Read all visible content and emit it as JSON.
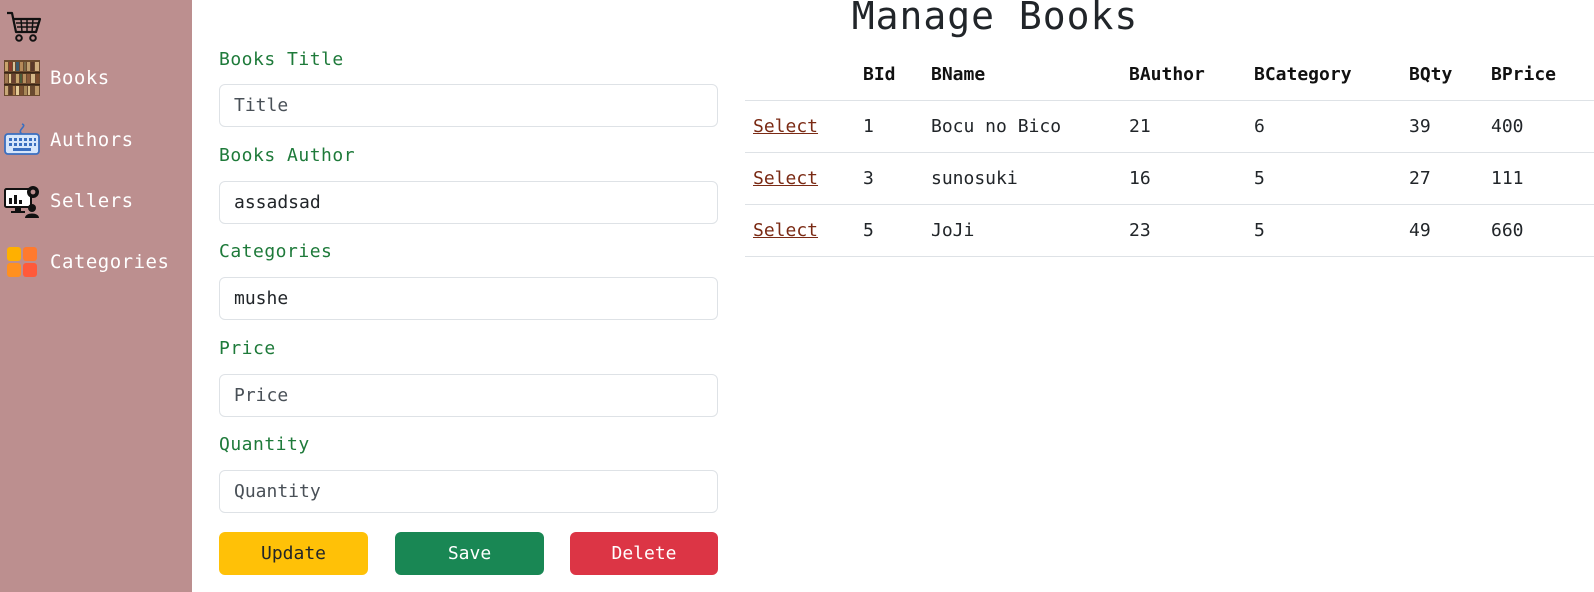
{
  "sidebar": {
    "items": [
      {
        "label": "Books"
      },
      {
        "label": "Authors"
      },
      {
        "label": "Sellers"
      },
      {
        "label": "Categories"
      }
    ]
  },
  "page_title": "Manage Books",
  "form": {
    "title_label": "Books Title",
    "title_placeholder": "Title",
    "title_value": "",
    "author_label": "Books Author",
    "author_value": "assadsad",
    "category_label": "Categories",
    "category_value": "mushe",
    "price_label": "Price",
    "price_placeholder": "Price",
    "price_value": "",
    "quantity_label": "Quantity",
    "quantity_placeholder": "Quantity",
    "quantity_value": ""
  },
  "buttons": {
    "update": "Update",
    "save": "Save",
    "delete": "Delete"
  },
  "table": {
    "headers": [
      "",
      "BId",
      "BName",
      "BAuthor",
      "BCategory",
      "BQty",
      "BPrice"
    ],
    "select_label": "Select",
    "rows": [
      {
        "id": "1",
        "name": "Bocu no Bico",
        "author": "21",
        "category": "6",
        "qty": "39",
        "price": "400"
      },
      {
        "id": "3",
        "name": "sunosuki",
        "author": "16",
        "category": "5",
        "qty": "27",
        "price": "111"
      },
      {
        "id": "5",
        "name": "JoJi",
        "author": "23",
        "category": "5",
        "qty": "49",
        "price": "660"
      }
    ]
  },
  "colors": {
    "sidebar_bg": "#bc8f8f",
    "label_green": "#1e7a3a",
    "update": "#ffc107",
    "save": "#198754",
    "delete": "#dc3545"
  }
}
